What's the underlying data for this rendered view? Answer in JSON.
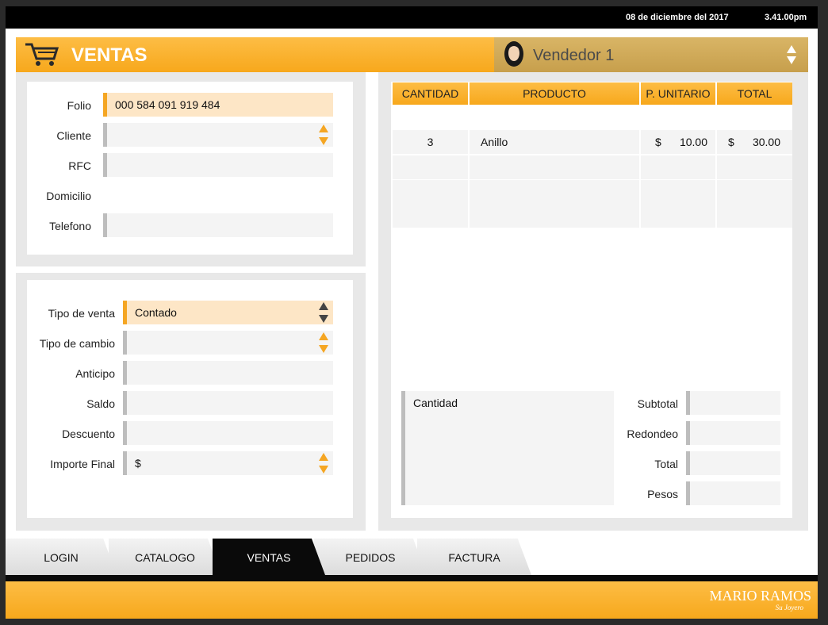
{
  "status_bar": {
    "date": "08 de diciembre del 2017",
    "time": "3.41.00pm"
  },
  "header": {
    "title": "VENTAS",
    "icon": "cart-icon"
  },
  "vendor": {
    "selected": "Vendedor 1"
  },
  "client_form": {
    "folio_label": "Folio",
    "folio_value": "000 584 091 919 484",
    "cliente_label": "Cliente",
    "cliente_value": "",
    "rfc_label": "RFC",
    "rfc_value": "",
    "domicilio_label": "Domicilio",
    "telefono_label": "Telefono",
    "telefono_value": ""
  },
  "sale_form": {
    "tipo_venta_label": "Tipo de venta",
    "tipo_venta_value": "Contado",
    "tipo_cambio_label": "Tipo de cambio",
    "tipo_cambio_value": "",
    "anticipo_label": "Anticipo",
    "anticipo_value": "",
    "saldo_label": "Saldo",
    "saldo_value": "",
    "descuento_label": "Descuento",
    "descuento_value": "",
    "importe_label": "Importe Final",
    "importe_value": "$"
  },
  "items_table": {
    "headers": [
      "CANTIDAD",
      "PRODUCTO",
      "P. UNITARIO",
      "TOTAL"
    ],
    "rows": [
      {
        "cantidad": "3",
        "producto": "Anillo",
        "unit_cur": "$",
        "unit": "10.00",
        "total_cur": "$",
        "total": "30.00"
      }
    ]
  },
  "summary": {
    "cantidad_label": "Cantidad",
    "subtotal_label": "Subtotal",
    "redondeo_label": "Redondeo",
    "total_label": "Total",
    "pesos_label": "Pesos"
  },
  "tabs": [
    "LOGIN",
    "CATALOGO",
    "VENTAS",
    "PEDIDOS",
    "FACTURA"
  ],
  "selected_tab": "VENTAS",
  "brand": {
    "name": "MARIO RAMOS",
    "tagline": "Su Joyero"
  },
  "colors": {
    "accent": "#f7a81c",
    "field_active": "#fde6c6",
    "field": "#f4f4f4"
  }
}
